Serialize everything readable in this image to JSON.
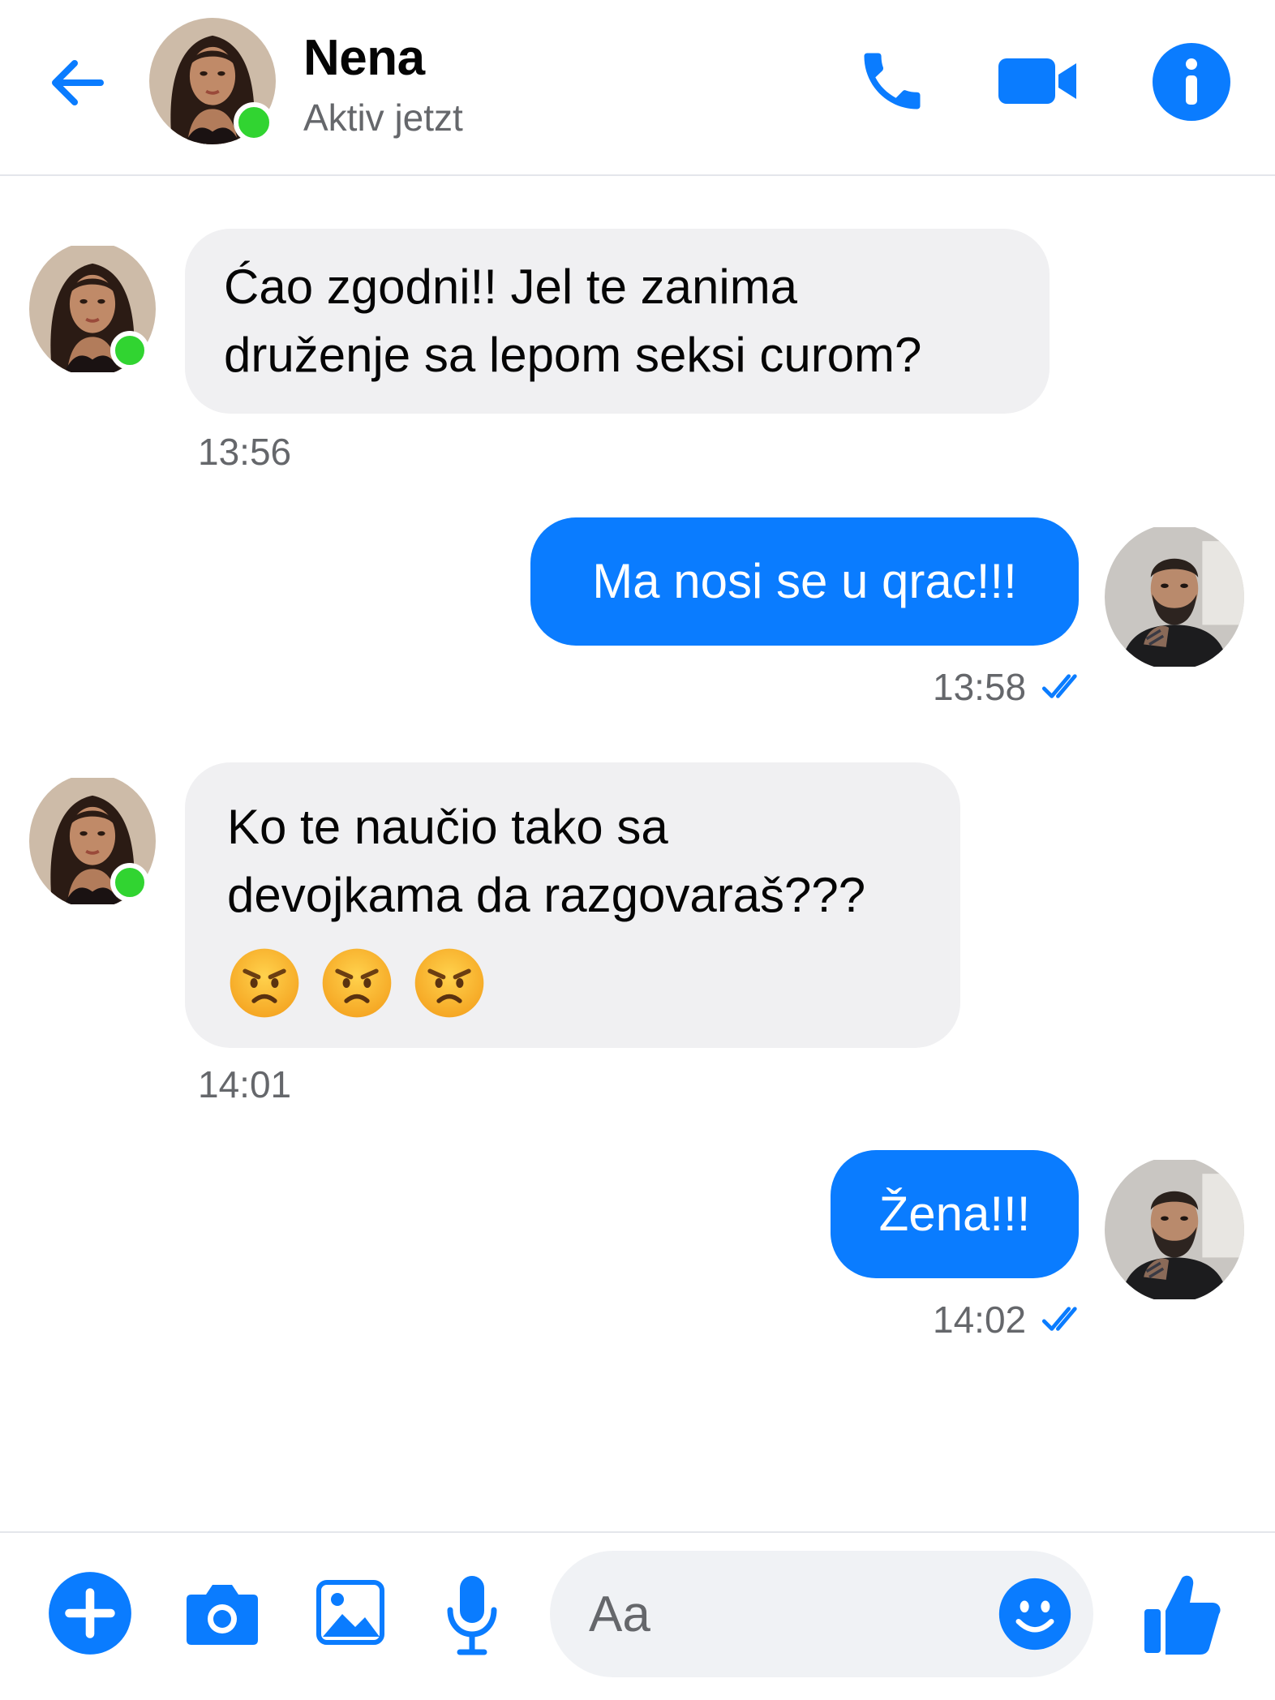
{
  "header": {
    "contact_name": "Nena",
    "status": "Aktiv jetzt",
    "back_icon": "arrow-left-icon",
    "call_icon": "phone-icon",
    "video_icon": "video-camera-icon",
    "info_icon": "info-icon"
  },
  "messages": [
    {
      "direction": "incoming",
      "lines": [
        "Ćao zgodni!! Jel te zanima",
        "druženje sa lepom seksi curom?"
      ],
      "time": "13:56"
    },
    {
      "direction": "outgoing",
      "lines": [
        "Ma nosi se u qrac!!!"
      ],
      "time": "13:58",
      "read_icon": "double-check-icon"
    },
    {
      "direction": "incoming",
      "lines": [
        "Ko te naučio tako sa",
        "devojkama da razgovaraš???"
      ],
      "emojis": [
        "angry-face-emoji",
        "angry-face-emoji",
        "angry-face-emoji"
      ],
      "time": "14:01"
    },
    {
      "direction": "outgoing",
      "lines": [
        "Žena!!!"
      ],
      "time": "14:02",
      "read_icon": "double-check-icon"
    }
  ],
  "composer": {
    "placeholder": "Aa",
    "icons": [
      "plus-icon",
      "camera-icon",
      "image-icon",
      "microphone-icon",
      "emoji-smile-icon",
      "thumbs-up-icon"
    ]
  },
  "colors": {
    "accent": "#0a7cff",
    "incoming_bubble": "#f0f0f2",
    "online": "#31d431",
    "muted_text": "#65676b"
  }
}
